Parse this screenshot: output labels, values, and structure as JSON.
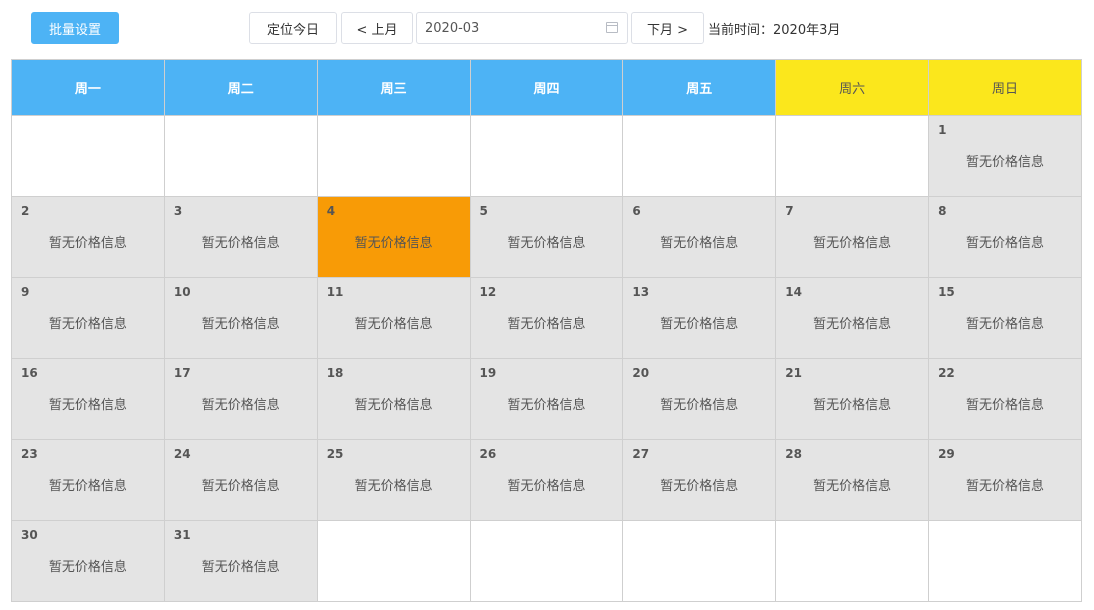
{
  "toolbar": {
    "batch_label": "批量设置",
    "today_label": "定位今日",
    "prev_label": "< 上月",
    "date_value": "2020-03",
    "next_label": "下月 >",
    "current_time_label": "当前时间：",
    "current_time_value": "2020年3月"
  },
  "weekdays": [
    "周一",
    "周二",
    "周三",
    "周四",
    "周五",
    "周六",
    "周日"
  ],
  "no_price_label": "暂无价格信息",
  "today_day": 4,
  "weeks": [
    [
      "",
      "",
      "",
      "",
      "",
      "",
      "1"
    ],
    [
      "2",
      "3",
      "4",
      "5",
      "6",
      "7",
      "8"
    ],
    [
      "9",
      "10",
      "11",
      "12",
      "13",
      "14",
      "15"
    ],
    [
      "16",
      "17",
      "18",
      "19",
      "20",
      "21",
      "22"
    ],
    [
      "23",
      "24",
      "25",
      "26",
      "27",
      "28",
      "29"
    ],
    [
      "30",
      "31",
      "",
      "",
      "",
      "",
      ""
    ]
  ],
  "colors": {
    "header_weekday": "#4db3f5",
    "header_weekend": "#fbe71c",
    "day_bg": "#e4e4e4",
    "today_bg": "#f89b06",
    "primary_button": "#4db3f5"
  }
}
